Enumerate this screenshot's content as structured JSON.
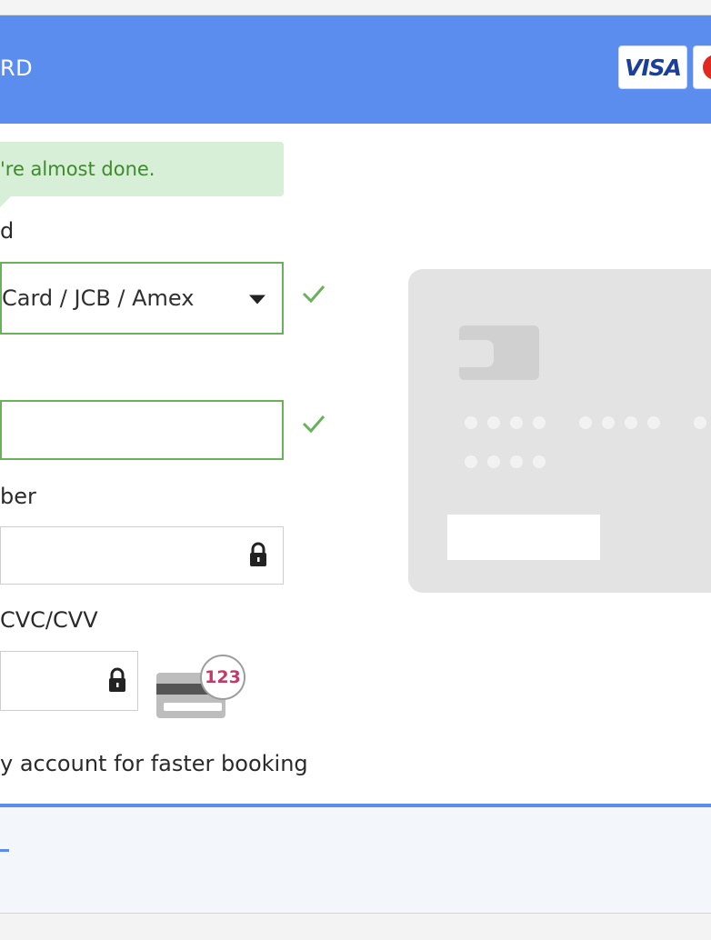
{
  "header": {
    "title": "RD",
    "card_brands": [
      "VISA",
      "Mastercard"
    ]
  },
  "notice": {
    "text": "'re almost done."
  },
  "form": {
    "card_type": {
      "label": "d",
      "value": "Card / JCB / Amex"
    },
    "name_on_card": {
      "value": ""
    },
    "card_number": {
      "label": "ber",
      "value": ""
    },
    "cvc": {
      "label": "CVC/CVV",
      "value": "",
      "hint_number": "123"
    },
    "save_account": {
      "label": "y account for faster booking"
    }
  },
  "colors": {
    "header_blue": "#5b8def",
    "success_green": "#68b25a",
    "notice_bg": "#d7eed7",
    "card_gray": "#e3e3e3"
  },
  "icons": [
    "check-icon",
    "lock-icon",
    "dropdown-caret-icon",
    "cvc-card-icon",
    "chip-icon"
  ]
}
